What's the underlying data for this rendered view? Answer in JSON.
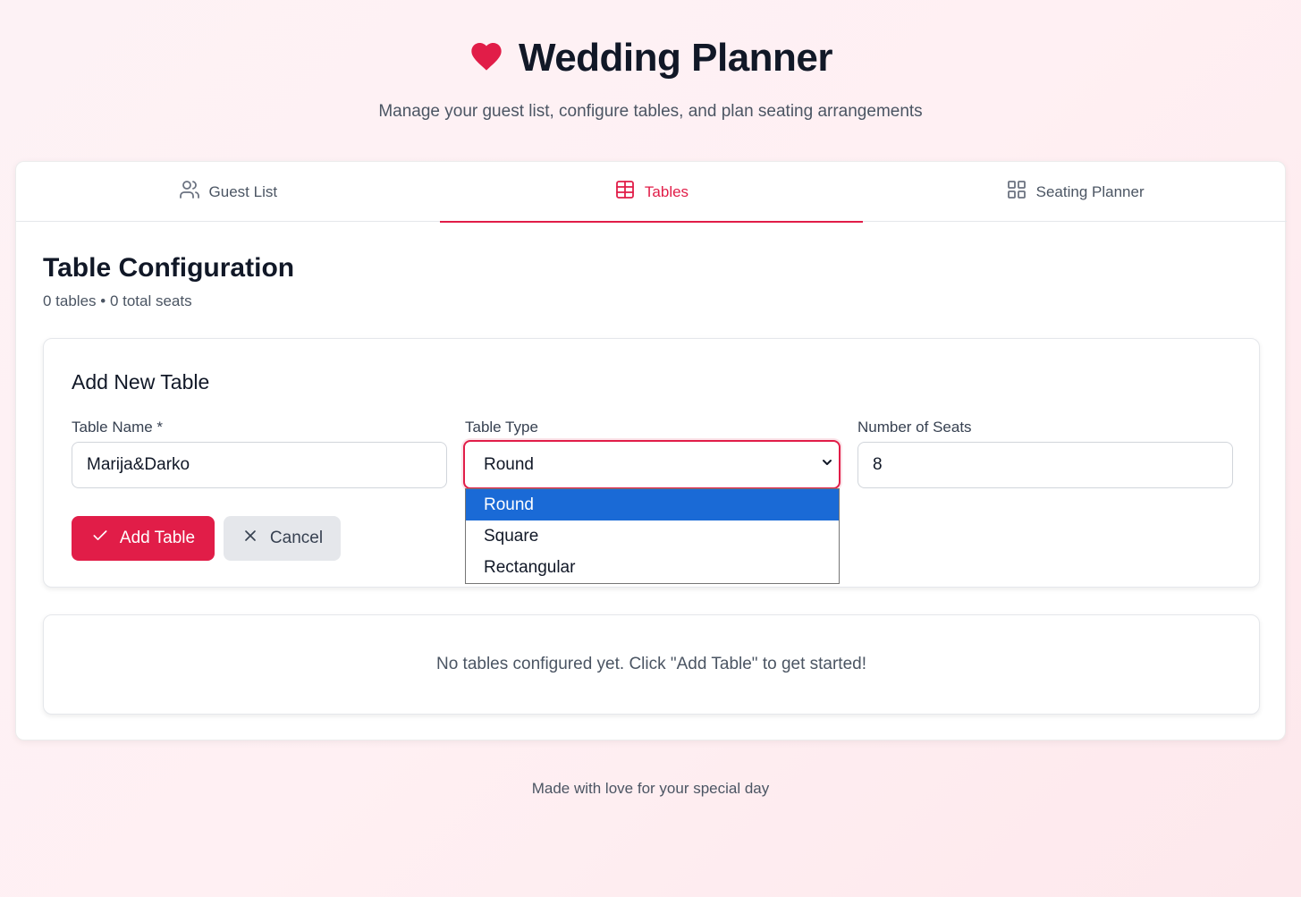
{
  "app": {
    "title": "Wedding Planner",
    "subtitle": "Manage your guest list, configure tables, and plan seating arrangements",
    "accent": "#e11d48"
  },
  "tabs": [
    {
      "label": "Guest List",
      "icon": "users-icon",
      "active": false
    },
    {
      "label": "Tables",
      "icon": "table-grid-icon",
      "active": true
    },
    {
      "label": "Seating Planner",
      "icon": "layout-grid-icon",
      "active": false
    }
  ],
  "section": {
    "title": "Table Configuration",
    "summary": "0 tables • 0 total seats"
  },
  "form": {
    "title": "Add New Table",
    "name_label": "Table Name *",
    "name_value": "Marija&Darko",
    "type_label": "Table Type",
    "type_value": "Round",
    "type_options": [
      "Round",
      "Square",
      "Rectangular"
    ],
    "seats_label": "Number of Seats",
    "seats_value": "8",
    "add_button": "Add Table",
    "cancel_button": "Cancel"
  },
  "empty_state": "No tables configured yet. Click \"Add Table\" to get started!",
  "footer": "Made with love for your special day"
}
